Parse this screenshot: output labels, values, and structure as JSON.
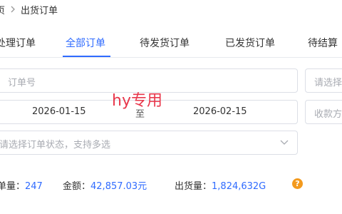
{
  "breadcrumb": {
    "home_partial": "页",
    "current": "出货订单"
  },
  "tabs": [
    {
      "label": "处理订单"
    },
    {
      "label": "全部订单"
    },
    {
      "label": "待发货订单"
    },
    {
      "label": "已发货订单"
    },
    {
      "label": "待结算"
    }
  ],
  "active_tab": "全部订单",
  "filters": {
    "order_no_placeholder": "订单号",
    "right_select_placeholder": "请选择",
    "date_start": "2026-01-15",
    "date_separator": "至",
    "date_end": "2026-02-15",
    "payment_placeholder": "收款方",
    "status_placeholder": "请选择订单状态，支持多选"
  },
  "watermark": "hy专用",
  "summary": {
    "count_label": "单量：",
    "count_value": "247",
    "amount_label": "金额：",
    "amount_value": "42,857.03元",
    "shipped_label": "出货量：",
    "shipped_value": "1,824,632G"
  },
  "colors": {
    "accent": "#2f6bff",
    "help": "#f39a1e",
    "watermark": "#e8384c"
  },
  "icons": {
    "breadcrumb_sep": "chevron-right-icon",
    "dropdown": "chevron-down-icon",
    "help": "question-circle-icon"
  }
}
